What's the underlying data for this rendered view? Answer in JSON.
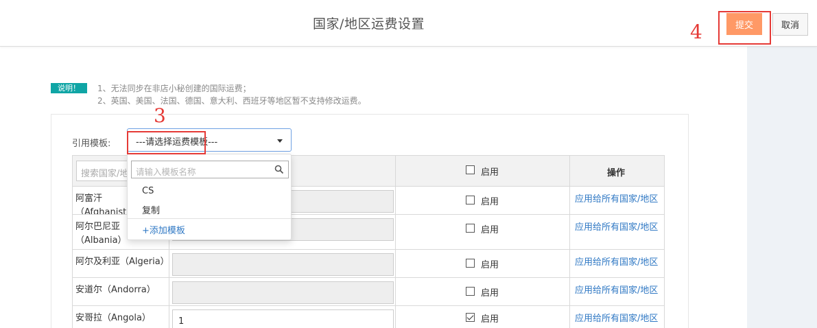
{
  "header": {
    "title": "国家/地区运费设置",
    "submit_label": "提交",
    "cancel_label": "取消"
  },
  "notice": {
    "badge": "说明！",
    "lines": [
      "1、无法同步在非店小秘创建的国际运费；",
      "2、英国、美国、法国、德国、意大利、西班牙等地区暂不支持修改运费。"
    ]
  },
  "template": {
    "label": "引用模板:",
    "selected": "---请选择运费模板---"
  },
  "dropdown": {
    "search_placeholder": "请输入模板名称",
    "options": [
      "CS",
      "复制"
    ],
    "add_label": "+添加模板"
  },
  "table": {
    "search_placeholder": "搜索国家/地区",
    "enable_header": "启用",
    "action_header": "操作",
    "enable_label": "启用",
    "action_label": "应用给所有国家/地区",
    "rows": [
      {
        "country": "阿富汗（Afghanistan）",
        "fee": "",
        "enabled": false
      },
      {
        "country": "阿尔巴尼亚（Albania）",
        "fee": "",
        "enabled": false
      },
      {
        "country": "阿尔及利亚（Algeria）",
        "fee": "",
        "enabled": false
      },
      {
        "country": "安道尔（Andorra）",
        "fee": "",
        "enabled": false
      },
      {
        "country": "安哥拉（Angola）",
        "fee": "1",
        "enabled": true
      }
    ]
  },
  "annotations": {
    "step3": "3",
    "step4": "4"
  },
  "colors": {
    "accent": "#ff9966",
    "badge": "#0fa5a5",
    "link": "#2f78c4",
    "annotation": "#e53935"
  }
}
